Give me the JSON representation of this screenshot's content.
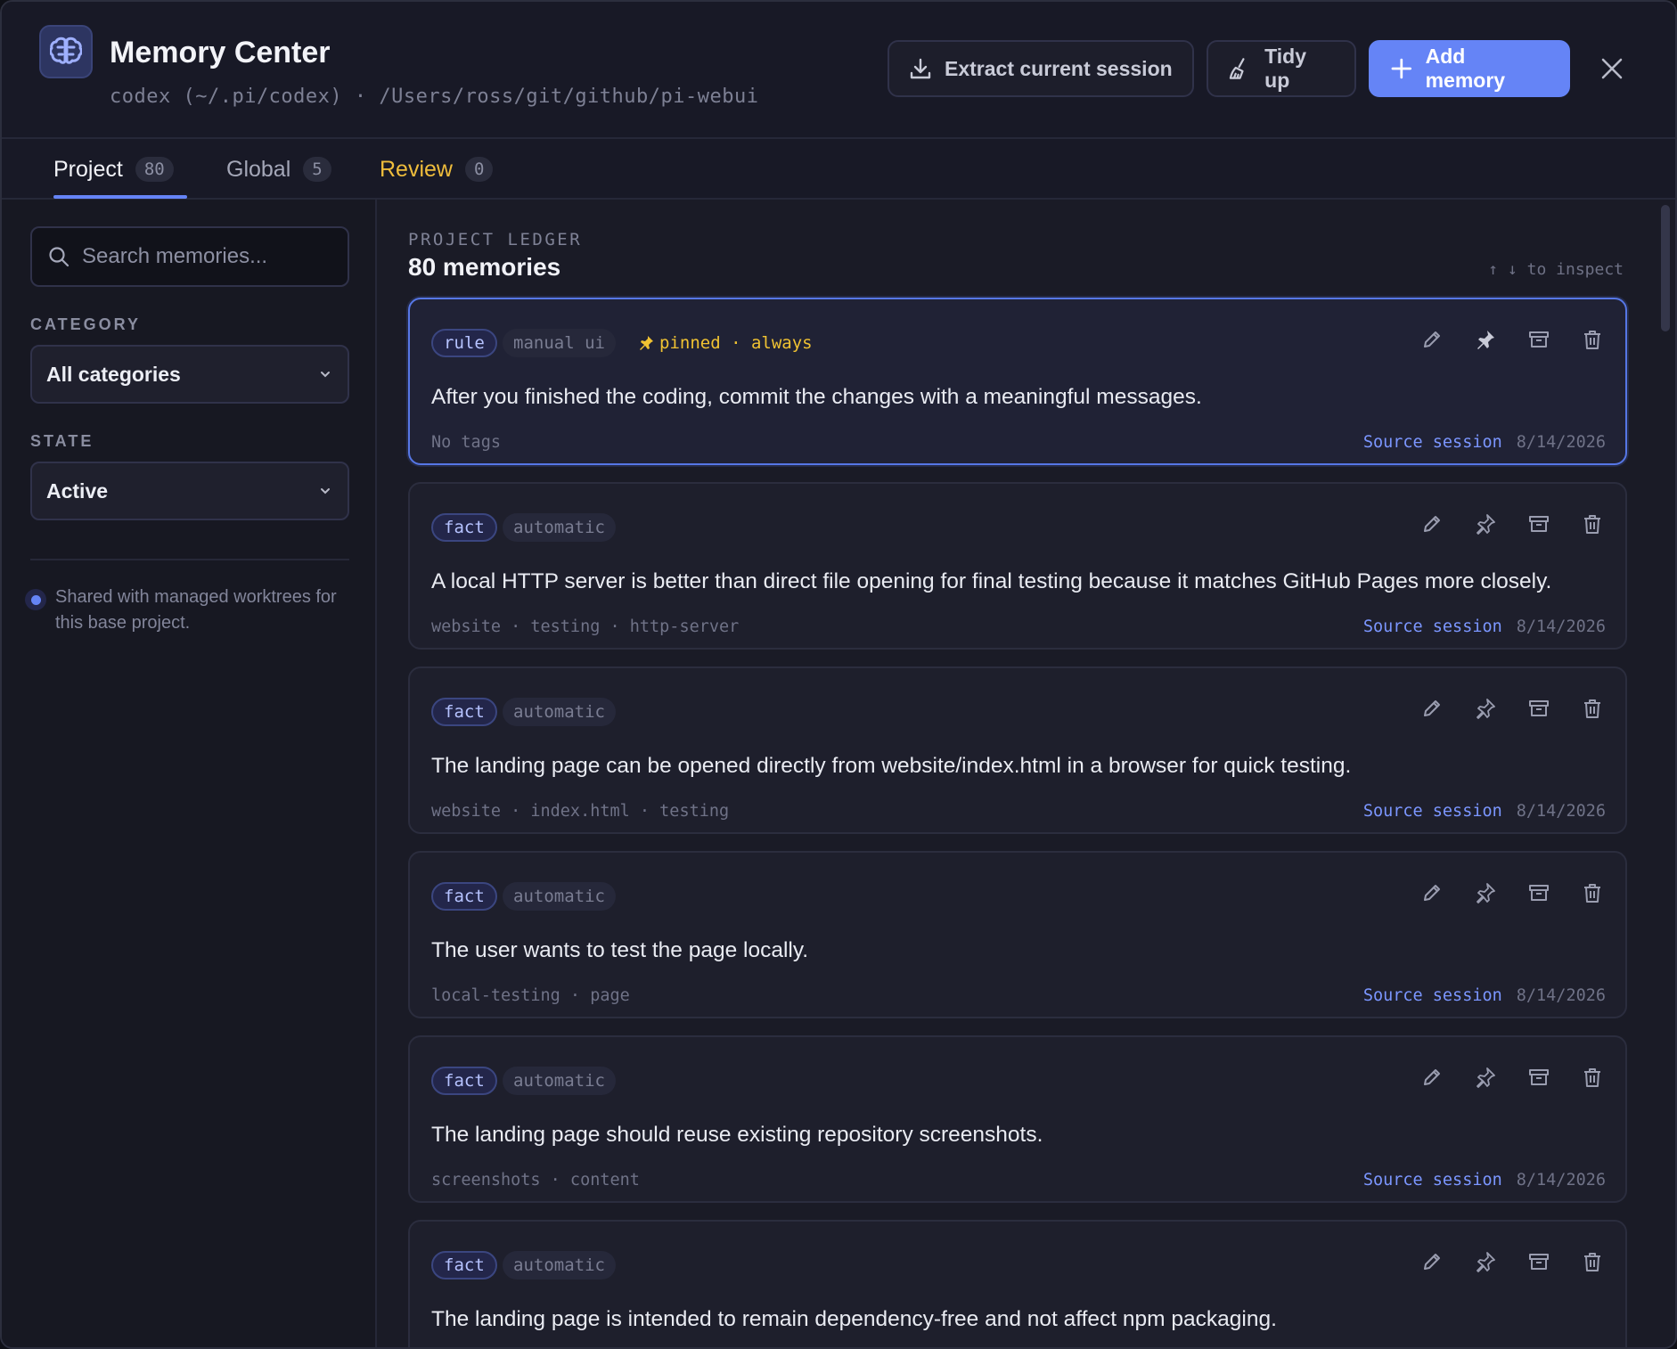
{
  "header": {
    "title": "Memory Center",
    "subtitle": "codex (~/.pi/codex) · /Users/ross/git/github/pi-webui",
    "logo_icon": "brain-icon",
    "buttons": {
      "extract": "Extract current session",
      "tidy": "Tidy up",
      "add": "Add memory"
    }
  },
  "tabs": [
    {
      "label": "Project",
      "count": "80",
      "active": true
    },
    {
      "label": "Global",
      "count": "5"
    },
    {
      "label": "Review",
      "count": "0"
    }
  ],
  "sidebar": {
    "search_placeholder": "Search memories...",
    "category_label": "CATEGORY",
    "category_value": "All categories",
    "state_label": "STATE",
    "state_value": "Active",
    "shared_note": "Shared with managed worktrees for this base project."
  },
  "main": {
    "ledger_label": "PROJECT LEDGER",
    "ledger_count": "80 memories",
    "inspect_hint": "↑ ↓ to inspect",
    "cards": [
      {
        "category": "rule",
        "source": "manual ui",
        "pinned": "pinned · always",
        "text": "After you finished the coding, commit the changes with a meaningful messages.",
        "tags": "No tags",
        "link": "Source session",
        "date": "8/14/2026"
      },
      {
        "category": "fact",
        "source": "automatic",
        "text": "A local HTTP server is better than direct file opening for final testing because it matches GitHub Pages more closely.",
        "tags": "website · testing · http-server",
        "link": "Source session",
        "date": "8/14/2026"
      },
      {
        "category": "fact",
        "source": "automatic",
        "text": "The landing page can be opened directly from website/index.html in a browser for quick testing.",
        "tags": "website · index.html · testing",
        "link": "Source session",
        "date": "8/14/2026"
      },
      {
        "category": "fact",
        "source": "automatic",
        "text": "The user wants to test the page locally.",
        "tags": "local-testing · page",
        "link": "Source session",
        "date": "8/14/2026"
      },
      {
        "category": "fact",
        "source": "automatic",
        "text": "The landing page should reuse existing repository screenshots.",
        "tags": "screenshots · content",
        "link": "Source session",
        "date": "8/14/2026"
      },
      {
        "category": "fact",
        "source": "automatic",
        "text": "The landing page is intended to remain dependency-free and not affect npm packaging.",
        "tags": "",
        "link": "",
        "date": ""
      }
    ]
  },
  "colors": {
    "accent": "#6584f6",
    "review": "#efbd3c",
    "pinned": "#f0c232",
    "link": "#7b96ff"
  }
}
